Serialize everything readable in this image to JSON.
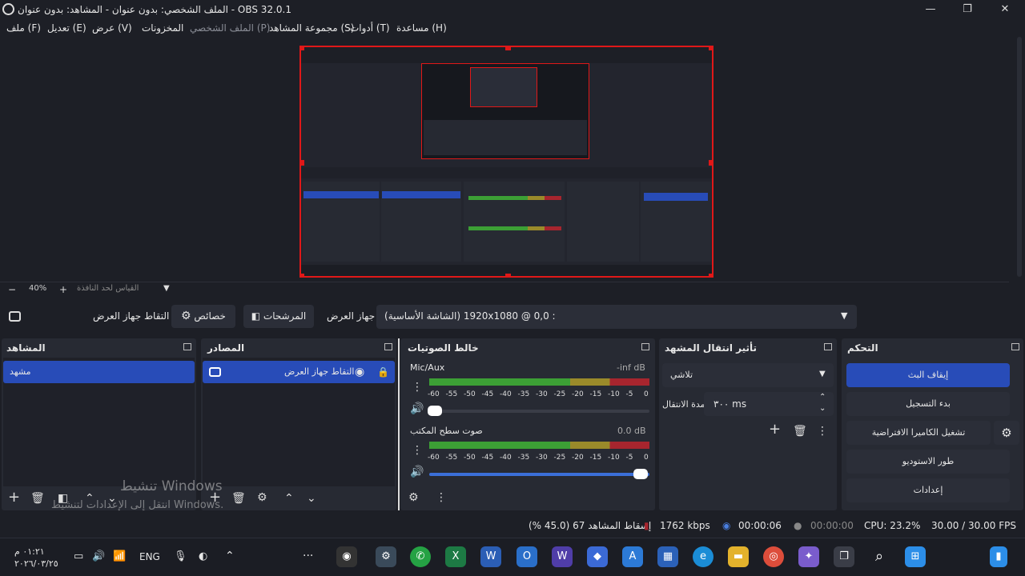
{
  "window": {
    "title": "الملف الشخصي: بدون عنوان - المشاهد: بدون عنوان - OBS 32.0.1",
    "minimize": "—",
    "maximize": "❐",
    "close": "✕"
  },
  "menu": [
    "ملف (F)",
    "تعديل (E)",
    "عرض (V)",
    "المخزونات",
    "الملف الشخصي (P)",
    "مجموعة المشاهد (S)",
    "أدوات (T)",
    "مساعدة (H)"
  ],
  "zoom": {
    "minus": "−",
    "value": "40%",
    "plus": "+",
    "scale_label": "القياس لحد النافذة"
  },
  "source_toolbar": {
    "source_name": "التقاط جهاز العرض",
    "properties": "خصائص",
    "filters": "المرشحات",
    "device_label": "جهاز العرض",
    "device_value": "(الشاشة الأساسية) 1920x1080 @ 0,0 :"
  },
  "scenes": {
    "title": "المشاهد",
    "items": [
      "مشهد"
    ]
  },
  "sources": {
    "title": "المصادر",
    "items": [
      "التقاط جهاز العرض"
    ]
  },
  "mixer": {
    "title": "خالط الصوتيات",
    "channels": [
      {
        "name": "Mic/Aux",
        "level": "-inf dB",
        "volume": 0.02
      },
      {
        "name": "صوت سطح المكتب",
        "level": "0.0 dB",
        "volume": 1.0
      }
    ],
    "ticks": [
      "-60",
      "-55",
      "-50",
      "-45",
      "-40",
      "-35",
      "-30",
      "-25",
      "-20",
      "-15",
      "-10",
      "-5",
      "0"
    ]
  },
  "transitions": {
    "title": "تأثير انتقال المشهد",
    "type": "تلاشي",
    "duration_label": "مدة الانتقال",
    "duration_value": "٣٠٠ ms"
  },
  "controls": {
    "title": "التحكم",
    "stop_stream": "إيقاف البث",
    "start_record": "بدء التسجيل",
    "virtual_cam": "تشغيل الكاميرا الافتراضية",
    "studio_mode": "طور الاستوديو",
    "settings": "إعدادات"
  },
  "watermark": {
    "line1": "تنشيط Windows",
    "line2": "انتقل إلى الإعدادات لتنشيط Windows."
  },
  "status": {
    "dropped": "إسقاط المشاهد 67 (45.0 %)",
    "bitrate": "1762 kbps",
    "stream_time": "00:00:06",
    "record_time": "00:00:00",
    "cpu": "CPU: 23.2%",
    "fps": "30.00 / 30.00 FPS"
  },
  "taskbar": {
    "time": "٠١:٢١ م",
    "date": "٢٠٢٦/٠٣/٢٥",
    "lang": "ENG",
    "more": "···"
  },
  "colors": {
    "accent": "#284cb8",
    "selection_border": "#e01818",
    "meter_green": "#3c9f35",
    "meter_yellow": "#9a8a2a",
    "meter_red": "#a7252e"
  }
}
